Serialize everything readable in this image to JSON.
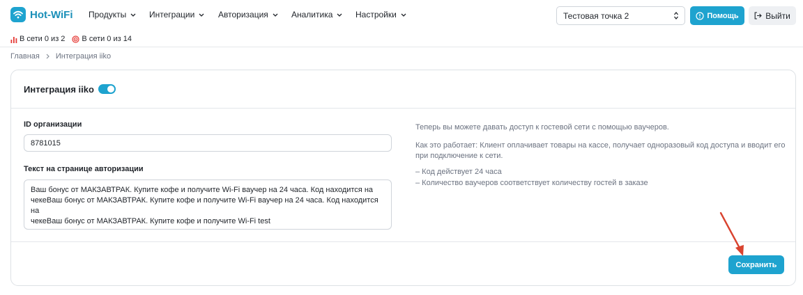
{
  "brand": {
    "name": "Hot-WiFi",
    "color": "#1ea3cf"
  },
  "nav": [
    {
      "label": "Продукты"
    },
    {
      "label": "Интеграции"
    },
    {
      "label": "Авторизация"
    },
    {
      "label": "Аналитика"
    },
    {
      "label": "Настройки"
    }
  ],
  "point_select": {
    "value": "Тестовая точка 2"
  },
  "help_button": {
    "label": "Помощь"
  },
  "logout_button": {
    "label": "Выйти"
  },
  "status": [
    {
      "text": "В сети 0 из 2",
      "icon": "bar-chart-icon",
      "color": "#e53935"
    },
    {
      "text": "В сети 0 из 14",
      "icon": "target-icon",
      "color": "#e53935"
    }
  ],
  "breadcrumb": {
    "home": "Главная",
    "current": "Интеграция iiko"
  },
  "card": {
    "title": "Интеграция iiko",
    "toggle_on": true,
    "org_id_label": "ID организации",
    "org_id_value": "8781015",
    "auth_text_label": "Текст на странице авторизации",
    "auth_text_lines": [
      "Ваш бонус от МАКЗАВТРАК. Купите кофе и получите Wi-Fi ваучер на 24 часа. Код находится на",
      "чекеВаш бонус от МАКЗАВТРАК. Купите кофе и получите Wi-Fi ваучер на 24 часа. Код находится на",
      "чекеВаш бонус от МАКЗАВТРАК. Купите кофе и получите Wi-Fi test"
    ],
    "info_intro": "Теперь вы можете давать доступ к гостевой сети с помощью ваучеров.",
    "info_how_line1": "Как это работает: Клиент оплачивает товары на кассе, получает одноразовый код доступа и вводит его",
    "info_how_line2": "при подключение к сети.",
    "info_bullets": [
      "– Код действует 24 часа",
      "– Количество ваучеров соответствует количеству гостей в заказе"
    ],
    "save_label": "Сохранить"
  },
  "annotation_color": "#d9432f"
}
